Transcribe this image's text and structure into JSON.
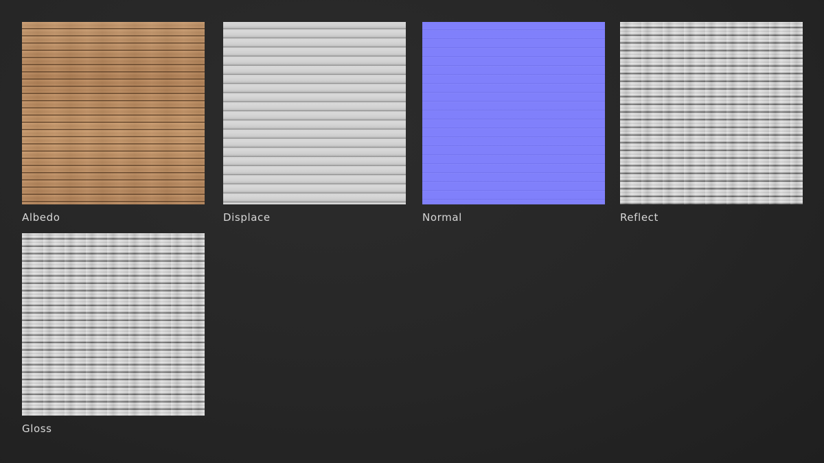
{
  "maps": [
    {
      "label": "Albedo",
      "preview": "wood-planks-albedo",
      "color": "#c3915f"
    },
    {
      "label": "Displace",
      "preview": "wood-planks-displacement",
      "color": "#cccccc"
    },
    {
      "label": "Normal",
      "preview": "wood-planks-normal",
      "color": "#8080fb"
    },
    {
      "label": "Reflect",
      "preview": "wood-planks-reflect",
      "color": "#cfcfcf"
    },
    {
      "label": "Gloss",
      "preview": "wood-planks-gloss",
      "color": "#d2d2d2"
    }
  ]
}
